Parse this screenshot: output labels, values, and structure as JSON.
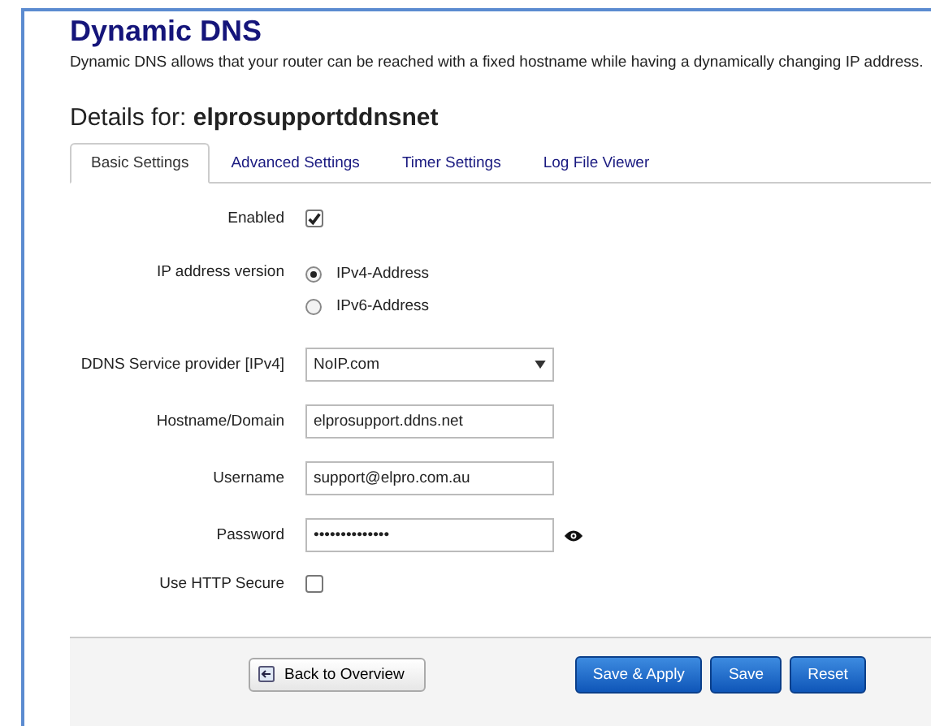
{
  "page": {
    "title": "Dynamic DNS",
    "description": "Dynamic DNS allows that your router can be reached with a fixed hostname while having a dynamically changing IP address.",
    "details_label": "Details for:",
    "details_name": "elprosupportddnsnet"
  },
  "tabs": [
    {
      "label": "Basic Settings",
      "selected": true
    },
    {
      "label": "Advanced Settings",
      "selected": false
    },
    {
      "label": "Timer Settings",
      "selected": false
    },
    {
      "label": "Log File Viewer",
      "selected": false
    }
  ],
  "fields": [
    {
      "kind": "checkbox",
      "label": "Enabled",
      "checked": true
    },
    {
      "kind": "radio",
      "label": "IP address version",
      "options": [
        {
          "label": "IPv4-Address",
          "selected": true
        },
        {
          "label": "IPv6-Address",
          "selected": false
        }
      ]
    },
    {
      "kind": "select",
      "label": "DDNS Service provider [IPv4]",
      "value": "NoIP.com"
    },
    {
      "kind": "text",
      "label": "Hostname/Domain",
      "value": "elprosupport.ddns.net"
    },
    {
      "kind": "text",
      "label": "Username",
      "value": "support@elpro.com.au"
    },
    {
      "kind": "password",
      "label": "Password",
      "value": "••••••••••••••"
    },
    {
      "kind": "checkbox",
      "label": "Use HTTP Secure",
      "checked": false
    }
  ],
  "footer": {
    "back": "Back to Overview",
    "buttons": [
      "Save & Apply",
      "Save",
      "Reset"
    ]
  }
}
